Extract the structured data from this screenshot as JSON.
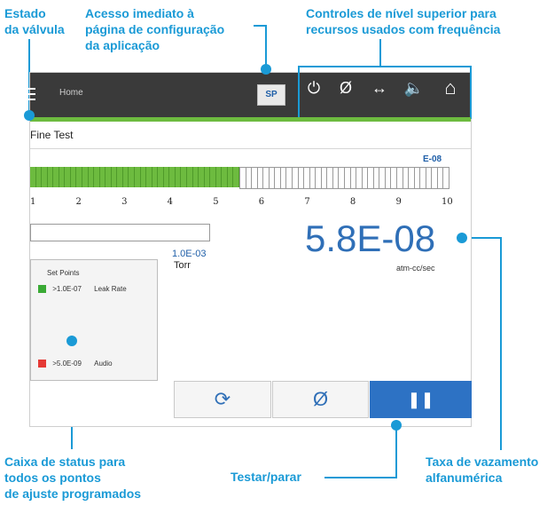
{
  "callouts": {
    "valve_state": [
      "Estado",
      "da válvula"
    ],
    "config_access": [
      "Acesso imediato à",
      "página de configuração",
      "da aplicação"
    ],
    "top_controls": [
      "Controles de nível superior para",
      "recursos usados com frequência"
    ],
    "status_box": [
      "Caixa de status para",
      "todos os pontos",
      "de ajuste programados"
    ],
    "test_stop": "Testar/parar",
    "leak_rate": [
      "Taxa de vazamento",
      "alfanumérica"
    ]
  },
  "topbar": {
    "menu_icon": "hamburger-icon",
    "home_label": "Home",
    "sp_label": "SP",
    "controls": [
      {
        "name": "power-icon",
        "glyph": "⏻"
      },
      {
        "name": "null-icon",
        "glyph": "Ø"
      },
      {
        "name": "swap-icon",
        "glyph": "↔"
      },
      {
        "name": "speaker-icon",
        "glyph": "🔈"
      },
      {
        "name": "home-icon",
        "glyph": "⌂"
      }
    ]
  },
  "screen": {
    "title": "Fine Test",
    "exponent_label": "E-08",
    "scale_ticks": [
      "1",
      "2",
      "3",
      "4",
      "5",
      "6",
      "7",
      "8",
      "9",
      "10"
    ],
    "leak_level_fraction": 0.5,
    "pressure_value": "1.0E-03",
    "pressure_unit": "Torr",
    "leak_rate_value": "5.8E-08",
    "leak_rate_unit": "atm-cc/sec"
  },
  "set_points": {
    "title": "Set Points",
    "items": [
      {
        "value": ">1.0E-07",
        "label": "Leak Rate",
        "color": "#3aaa35"
      },
      {
        "value": ">5.0E-09",
        "label": "Audio",
        "color": "#e53935"
      }
    ]
  },
  "buttons": {
    "refresh": "⟳",
    "zero": "Ø",
    "pause": "❚❚"
  },
  "colors": {
    "accent": "#1a9ad6",
    "green": "#6dbb3f",
    "blue": "#2d72c4"
  }
}
